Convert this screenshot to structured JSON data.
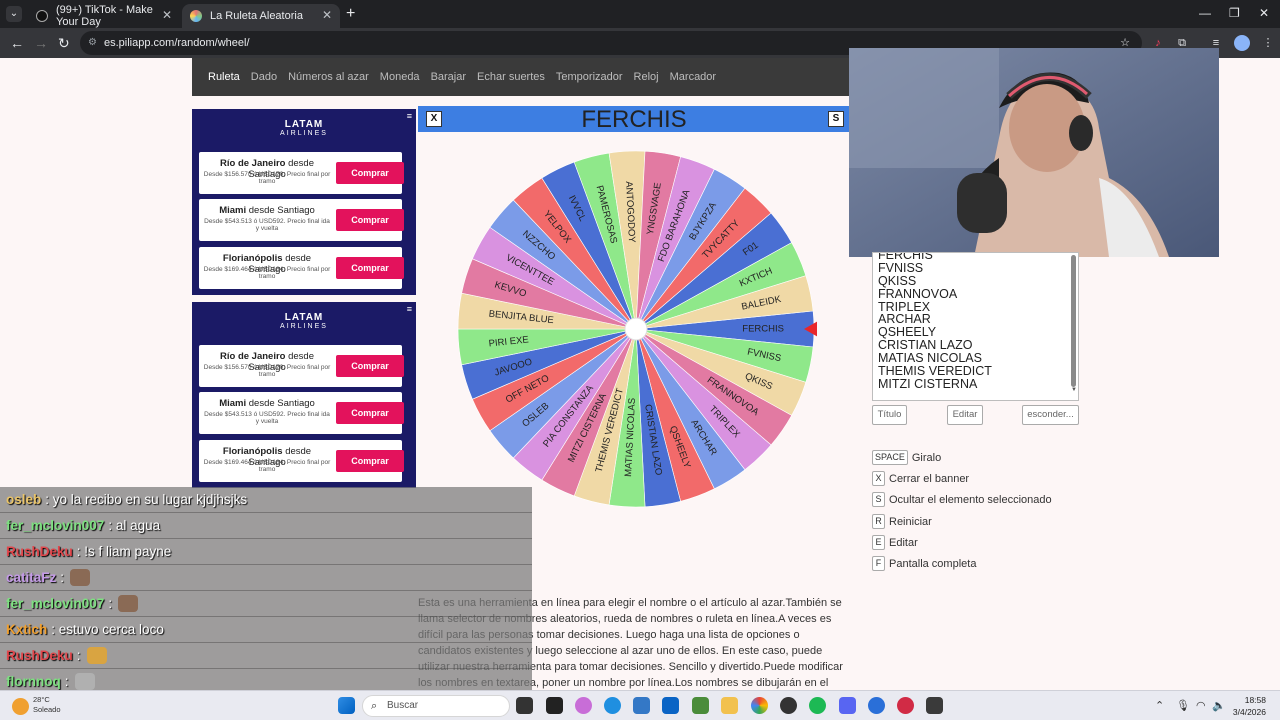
{
  "browser": {
    "tabs": [
      {
        "label": "(99+) TikTok - Make Your Day",
        "active": false
      },
      {
        "label": "La Ruleta Aleatoria",
        "active": true
      }
    ],
    "url": "es.piliapp.com/random/wheel/"
  },
  "sitenav": {
    "items": [
      "Ruleta",
      "Dado",
      "Números al azar",
      "Moneda",
      "Barajar",
      "Echar suertes",
      "Temporizador",
      "Reloj",
      "Marcador"
    ],
    "active": "Ruleta"
  },
  "ads": [
    {
      "brand": "LATAM",
      "brand_sub": "AIRLINES",
      "offers": [
        {
          "city": "Río de Janeiro",
          "from": "desde Santiago",
          "price": "Desde $156.570 ó USD170. Precio final por tramo",
          "button": "Comprar"
        },
        {
          "city": "Miami",
          "from": "desde Santiago",
          "price": "Desde $543.513 ó USD592. Precio final ida y vuelta",
          "button": "Comprar"
        },
        {
          "city": "Florianópolis",
          "from": "desde Santiago",
          "price": "Desde $169.464 ó USD184. Precio final por tramo",
          "button": "Comprar"
        }
      ]
    },
    {
      "brand": "LATAM",
      "brand_sub": "AIRLINES",
      "offers": [
        {
          "city": "Río de Janeiro",
          "from": "desde Santiago",
          "price": "Desde $156.570 ó USD170. Precio final por tramo",
          "button": "Comprar"
        },
        {
          "city": "Miami",
          "from": "desde Santiago",
          "price": "Desde $543.513 ó USD592. Precio final ida y vuelta",
          "button": "Comprar"
        },
        {
          "city": "Florianópolis",
          "from": "desde Santiago",
          "price": "Desde $169.464 ó USD184. Precio final por tramo",
          "button": "Comprar"
        }
      ]
    }
  ],
  "wheel": {
    "title": "FERCHIS",
    "close_label": "X",
    "s_label": "S",
    "segments": [
      "FERCHIS",
      "FVNISS",
      "QKISS",
      "FRANNOVOA",
      "TRIPLEX",
      "ARCHAR",
      "QSHEELY",
      "CRISTIAN LAZO",
      "MATIAS NICOLAS",
      "THEMIS VEREDICT",
      "MITZI CISTERNA",
      "PIA CONSTANZA",
      "OSLEB",
      "OFF NETO",
      "JAVOOO",
      "PIRI EXE",
      "BENJITA BLUE",
      "KEVVO",
      "VICENTTEE",
      "NZZCHO",
      "YELPOX",
      "IVVCL",
      "PAMEROSAS",
      "ANTOGODOY",
      "YNGSVAGE",
      "FDO BARAHONA",
      "BJYKPZA",
      "TVYCATTY",
      "F01",
      "KXTICH",
      "BALEIDK"
    ],
    "colors": [
      "#4a6fd3",
      "#8fe88a",
      "#f0d9a6",
      "#e27aa2",
      "#d992e0",
      "#7b9be8",
      "#f26a6a"
    ],
    "pointer_color": "#e8262b"
  },
  "names_list": [
    "FERCHIS",
    "FVNISS",
    "QKISS",
    "FRANNOVOA",
    "TRIPLEX",
    "ARCHAR",
    "QSHEELY",
    "CRISTIAN LAZO",
    "MATIAS NICOLAS",
    "THEMIS VEREDICT",
    "MITZI CISTERNA"
  ],
  "buttons": {
    "title": "Título",
    "edit": "Editar",
    "hide": "esconder..."
  },
  "shortcuts": [
    {
      "key": "SPACE",
      "label": "Giralo"
    },
    {
      "key": "X",
      "label": "Cerrar el banner"
    },
    {
      "key": "S",
      "label": "Ocultar el elemento seleccionado"
    },
    {
      "key": "R",
      "label": "Reiniciar"
    },
    {
      "key": "E",
      "label": "Editar"
    },
    {
      "key": "F",
      "label": "Pantalla completa"
    }
  ],
  "description": "Esta es una herramienta en línea para elegir el nombre o el artículo al azar.También se llama selector de nombres aleatorios, rueda de nombres o ruleta en línea.A veces es difícil para las personas tomar decisiones. Luego haga una lista de opciones o candidatos existentes y luego seleccione al azar uno de ellos. En este caso, puede utilizar nuestra herramienta para tomar decisiones. Sencillo y divertido.Puede modificar los nombres en textarea, poner un nombre por línea.Los nombres se dibujarán en el círculo.Simplemente haga clic en la rueda",
  "chat": [
    {
      "user": "osleb",
      "color": "#e9c46a",
      "message": ": yo la recibo en su lugar kjdjhsjks"
    },
    {
      "user": "fer_mclovin007",
      "color": "#7ee081",
      "message": ": al agua"
    },
    {
      "user": "RushDeku",
      "color": "#e0474c",
      "message": ": !s f liam payne"
    },
    {
      "user": "catitaFz",
      "color": "#c59be8",
      "message": ":",
      "emote": true
    },
    {
      "user": "fer_mclovin007",
      "color": "#7ee081",
      "message": ":",
      "emote": true
    },
    {
      "user": "Kxtich",
      "color": "#f0a030",
      "message": ": estuvo cerca loco"
    },
    {
      "user": "RushDeku",
      "color": "#e0474c",
      "message": ":",
      "emote": true
    },
    {
      "user": "flornnoq",
      "color": "#7ee081",
      "message": ":",
      "emote": true
    }
  ],
  "taskbar": {
    "search_placeholder": "Buscar",
    "weather": "28°C",
    "weather_sub": "Soleado",
    "time": "18:58",
    "date": "3/4/2026"
  }
}
